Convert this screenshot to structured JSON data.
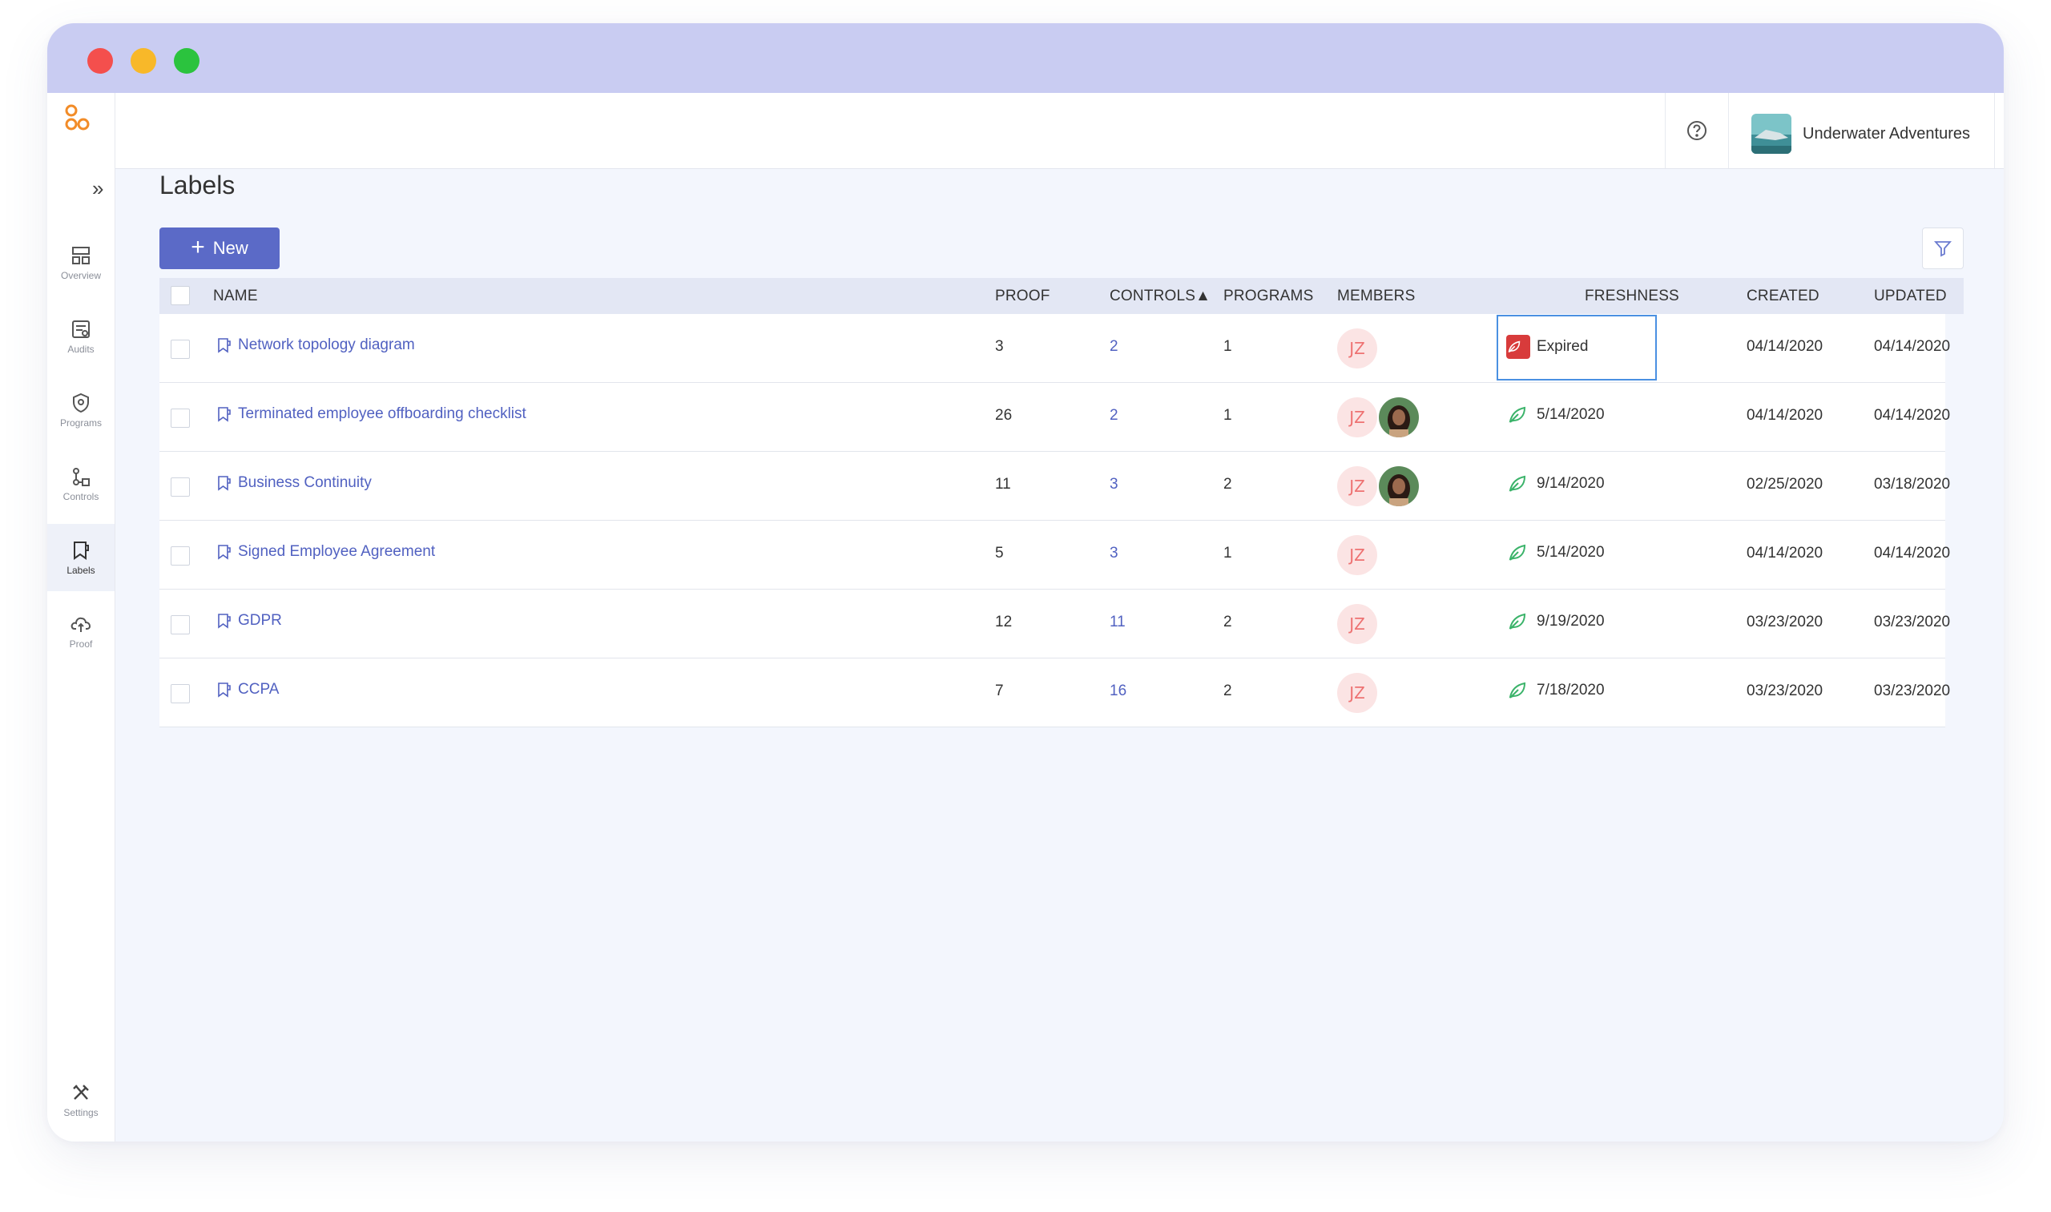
{
  "app": {
    "org_name": "Underwater Adventures",
    "user_initials": "JZ"
  },
  "sidebar": {
    "expand_icon": "double-chevron-right-icon",
    "items": [
      {
        "label": "Overview",
        "icon": "overview-icon"
      },
      {
        "label": "Audits",
        "icon": "audits-icon"
      },
      {
        "label": "Programs",
        "icon": "shield-icon"
      },
      {
        "label": "Controls",
        "icon": "controls-icon"
      },
      {
        "label": "Labels",
        "icon": "label-icon",
        "active": true
      },
      {
        "label": "Proof",
        "icon": "cloud-upload-icon"
      },
      {
        "label": "Settings",
        "icon": "tools-icon"
      }
    ]
  },
  "page": {
    "title": "Labels",
    "new_button": "New"
  },
  "table": {
    "columns": [
      "NAME",
      "PROOF",
      "CONTROLS",
      "PROGRAMS",
      "MEMBERS",
      "FRESHNESS",
      "CREATED",
      "UPDATED"
    ],
    "sort_indicator": "▲",
    "rows": [
      {
        "name": "Network topology diagram",
        "proof": "3",
        "controls": "2",
        "programs": "1",
        "members": [
          "JZ"
        ],
        "member_photo": false,
        "freshness": "Expired",
        "expired": true,
        "created": "04/14/2020",
        "updated": "04/14/2020"
      },
      {
        "name": "Terminated employee offboarding checklist",
        "proof": "26",
        "controls": "2",
        "programs": "1",
        "members": [
          "JZ"
        ],
        "member_photo": true,
        "freshness": "5/14/2020",
        "expired": false,
        "created": "04/14/2020",
        "updated": "04/14/2020"
      },
      {
        "name": "Business Continuity",
        "proof": "11",
        "controls": "3",
        "programs": "2",
        "members": [
          "JZ"
        ],
        "member_photo": true,
        "freshness": "9/14/2020",
        "expired": false,
        "created": "02/25/2020",
        "updated": "03/18/2020"
      },
      {
        "name": "Signed Employee Agreement",
        "proof": "5",
        "controls": "3",
        "programs": "1",
        "members": [
          "JZ"
        ],
        "member_photo": false,
        "freshness": "5/14/2020",
        "expired": false,
        "created": "04/14/2020",
        "updated": "04/14/2020"
      },
      {
        "name": "GDPR",
        "proof": "12",
        "controls": "11",
        "programs": "2",
        "members": [
          "JZ"
        ],
        "member_photo": false,
        "freshness": "9/19/2020",
        "expired": false,
        "created": "03/23/2020",
        "updated": "03/23/2020"
      },
      {
        "name": "CCPA",
        "proof": "7",
        "controls": "16",
        "programs": "2",
        "members": [
          "JZ"
        ],
        "member_photo": false,
        "freshness": "7/18/2020",
        "expired": false,
        "created": "03/23/2020",
        "updated": "03/23/2020"
      }
    ]
  },
  "colors": {
    "titlebar": "#c9ccf2",
    "accent": "#5b6ac7",
    "link": "#5161c1",
    "fresh_green": "#3bb36a",
    "expired_red": "#d83b3b"
  }
}
